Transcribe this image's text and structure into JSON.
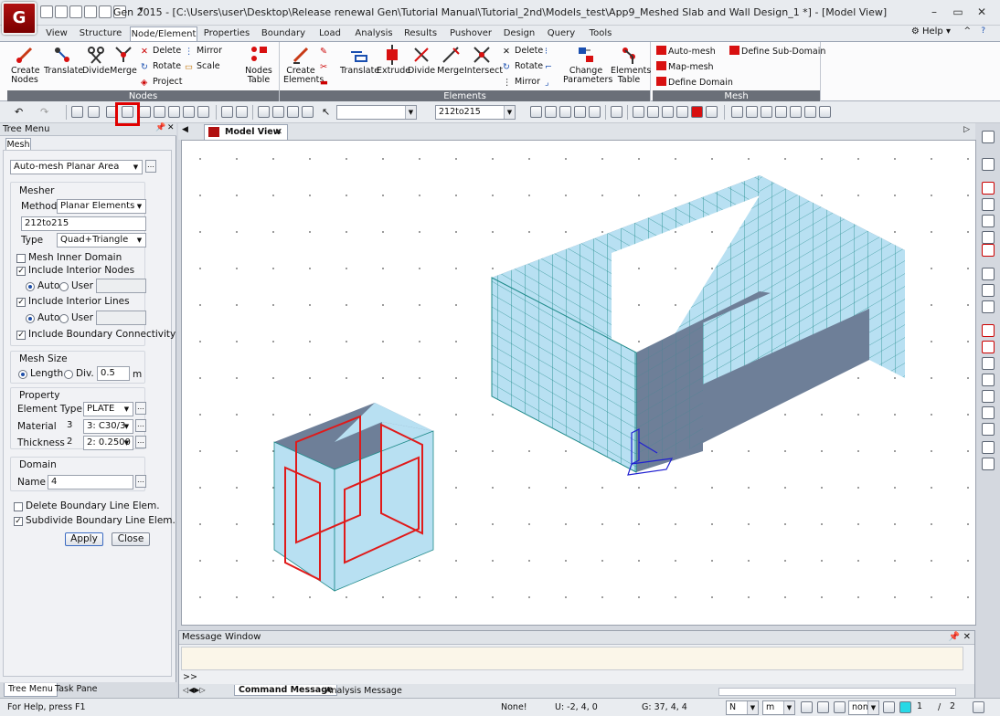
{
  "app": {
    "logo_text": "G",
    "title": "Gen 2015 - [C:\\Users\\user\\Desktop\\Release renewal Gen\\Tutorial Manual\\Tutorial_2nd\\Models_test\\App9_Meshed Slab and Wall Design_1 *] - [Model View]"
  },
  "menu": {
    "tabs": [
      "View",
      "Structure",
      "Node/Element",
      "Properties",
      "Boundary",
      "Load",
      "Analysis",
      "Results",
      "Pushover",
      "Design",
      "Query",
      "Tools"
    ],
    "active_tab": "Node/Element",
    "help_label": "Help"
  },
  "ribbon": {
    "nodes": {
      "label": "Nodes",
      "create_label": "Create Nodes",
      "translate_label": "Translate",
      "divide_label": "Divide",
      "merge_label": "Merge",
      "delete_label": "Delete",
      "rotate_label": "Rotate",
      "project_label": "Project",
      "mirror_label": "Mirror",
      "scale_label": "Scale",
      "table_label": "Nodes Table"
    },
    "elements": {
      "label": "Elements",
      "create_label": "Create Elements",
      "translate_label": "Translate",
      "extrude_label": "Extrude",
      "divide_label": "Divide",
      "merge_label": "Merge",
      "intersect_label": "Intersect",
      "delete_label": "Delete",
      "rotate_label": "Rotate",
      "mirror_label": "Mirror",
      "change_params_label": "Change Parameters",
      "table_label": "Elements Table"
    },
    "mesh": {
      "label": "Mesh",
      "automesh_label": "Auto-mesh",
      "mapmesh_label": "Map-mesh",
      "define_domain_label": "Define Domain",
      "define_subdomain_label": "Define Sub-Domain"
    }
  },
  "toolbar": {
    "select_combo_value": "",
    "group_combo_value": "212to215"
  },
  "tree_menu": {
    "title": "Tree Menu",
    "tab": "Mesh",
    "function_select": "Auto-mesh Planar Area",
    "mesher_section": "Mesher",
    "method_label": "Method",
    "method_value": "Planar Elements",
    "name_value": "212to215",
    "type_label": "Type",
    "type_value": "Quad+Triangle",
    "mesh_inner_domain": "Mesh Inner Domain",
    "include_interior_nodes": "Include Interior Nodes",
    "auto_label": "Auto",
    "user_label": "User",
    "include_interior_lines": "Include Interior Lines",
    "include_boundary_connectivity": "Include Boundary Connectivity",
    "mesh_size_section": "Mesh Size",
    "length_label": "Length",
    "div_label": "Div.",
    "size_value": "0.5",
    "size_unit": "m",
    "property_section": "Property",
    "element_type_label": "Element Type",
    "element_type_value": "PLATE",
    "material_label": "Material",
    "material_num": "3",
    "material_value": "3: C30/3",
    "thickness_label": "Thickness",
    "thickness_num": "2",
    "thickness_value": "2: 0.2500",
    "domain_section": "Domain",
    "domain_name_label": "Name",
    "domain_name_value": "4",
    "delete_boundary": "Delete Boundary Line Elem.",
    "subdivide_boundary": "Subdivide Boundary Line Elem.",
    "apply_label": "Apply",
    "close_label": "Close",
    "bottom_tab_tree": "Tree Menu",
    "bottom_tab_task": "Task Pane"
  },
  "view": {
    "tab_label": "Model View"
  },
  "message_window": {
    "title": "Message Window",
    "prompt": ">>",
    "tab_command": "Command Message",
    "tab_analysis": "Analysis Message"
  },
  "status": {
    "help": "For Help, press F1",
    "snap": "None!",
    "u_coord": "U: -2, 4, 0",
    "g_coord": "G: 37, 4, 4",
    "force_unit": "N",
    "length_unit": "m",
    "non_label": "non",
    "page_current": "1",
    "page_total": "2"
  },
  "colors": {
    "mesh_face": "#b8e0f2",
    "mesh_face_dark": "#6e7f98",
    "mesh_line": "#1f8a8a",
    "domain_red": "#e01a1a",
    "axis_blue": "#2020d0"
  }
}
